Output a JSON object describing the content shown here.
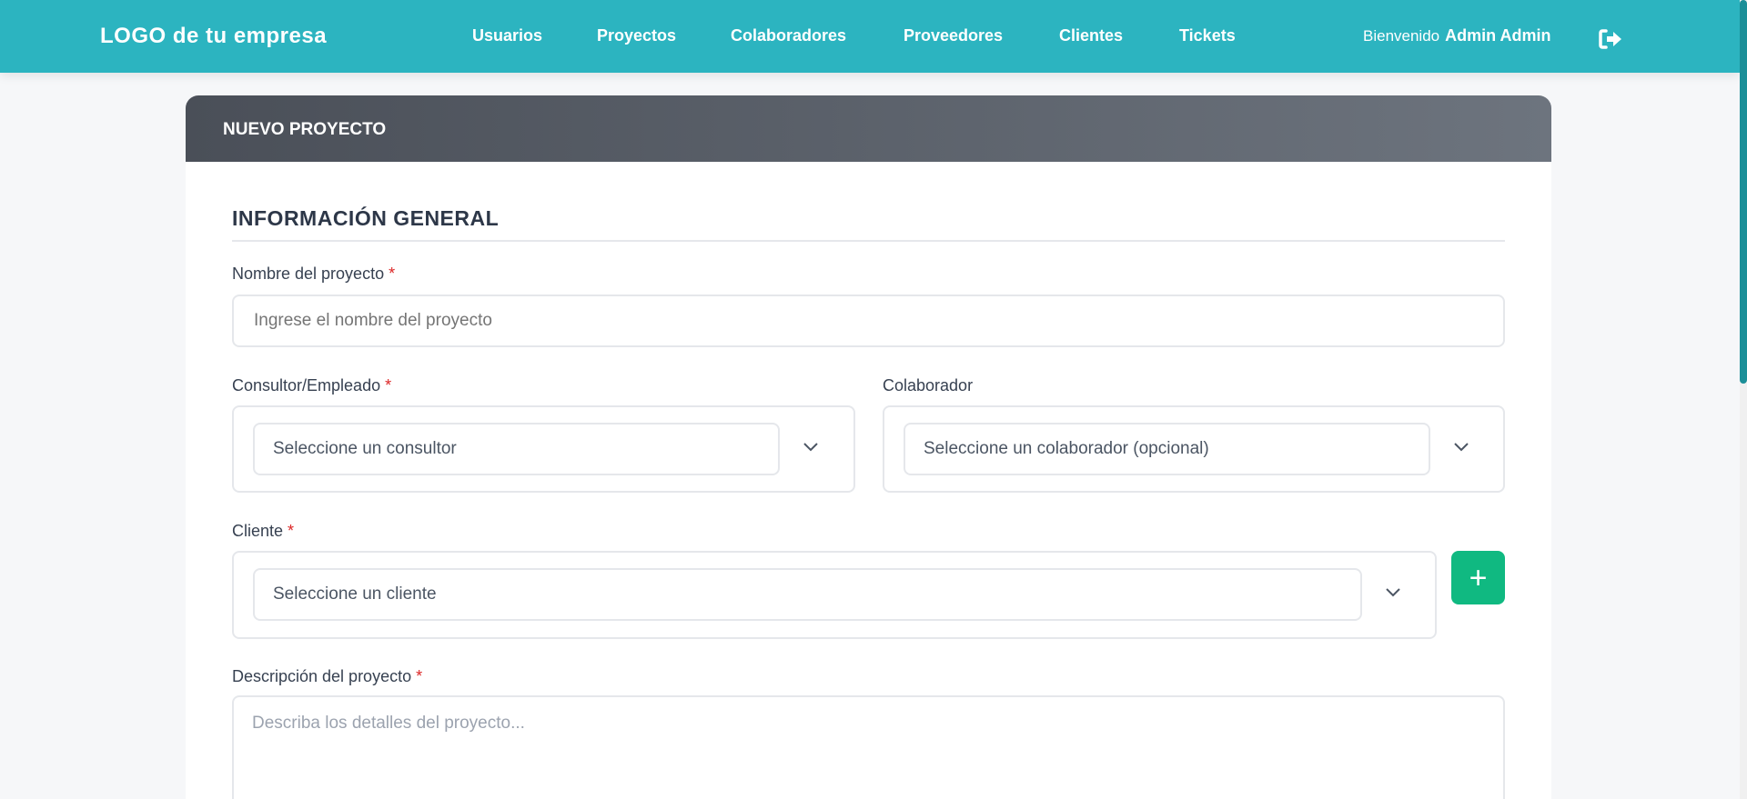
{
  "header": {
    "logo": "LOGO de tu empresa",
    "nav": [
      "Usuarios",
      "Proyectos",
      "Colaboradores",
      "Proveedores",
      "Clientes",
      "Tickets"
    ],
    "welcome": "Bienvenido",
    "user": "Admin Admin"
  },
  "card": {
    "title": "NUEVO PROYECTO",
    "section": "INFORMACIÓN GENERAL"
  },
  "form": {
    "required_mark": "*",
    "name": {
      "label": "Nombre del proyecto",
      "placeholder": "Ingrese el nombre del proyecto"
    },
    "consultor": {
      "label": "Consultor/Empleado",
      "value": "Seleccione un consultor"
    },
    "colaborador": {
      "label": "Colaborador",
      "value": "Seleccione un colaborador (opcional)"
    },
    "cliente": {
      "label": "Cliente",
      "value": "Seleccione un cliente",
      "add": "+"
    },
    "descripcion": {
      "label": "Descripción del proyecto",
      "placeholder": "Describa los detalles del proyecto..."
    }
  },
  "colors": {
    "brand": "#2cb4c0",
    "add": "#10b981"
  }
}
